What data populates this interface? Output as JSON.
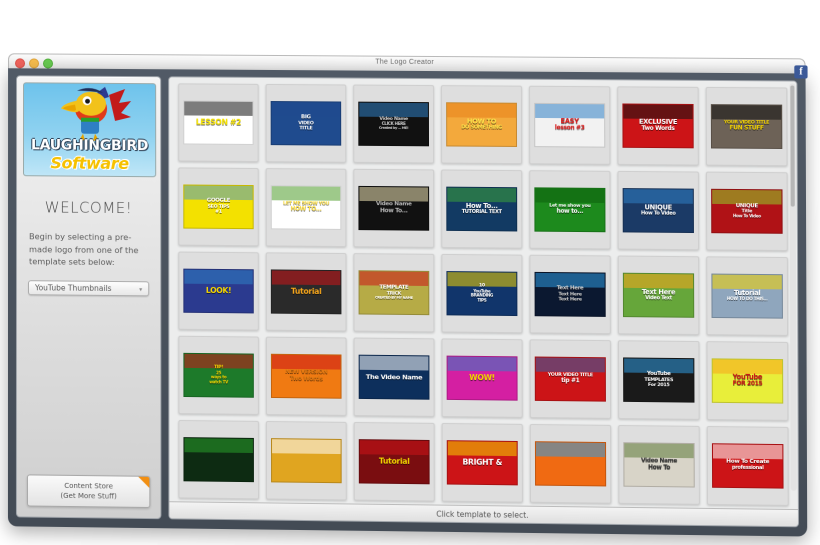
{
  "window": {
    "title": "The Logo Creator",
    "traffic_lights": [
      "close-red",
      "minimize-yellow",
      "zoom-green"
    ],
    "facebook_badge": "f"
  },
  "sidebar": {
    "logo": {
      "word1": "LAUGHINGBIRD",
      "word2": "Software",
      "icon": "parrot-mascot"
    },
    "welcome_heading": "WELCOME!",
    "instructions": "Begin by selecting a pre-made logo from one of the template sets below:",
    "template_set_select": {
      "value": "YouTube Thumbnails",
      "chevron": "▾"
    },
    "content_store": {
      "line1": "Content Store",
      "line2": "(Get More Stuff)",
      "corner_color": "#f28f12"
    }
  },
  "panel": {
    "status_text": "Click template to select.",
    "templates": [
      {
        "name": "lesson-2",
        "lines": [
          "LESSON #2"
        ],
        "bg": "#ffffff",
        "fg": "#f7e400",
        "accent": "#111111",
        "style": "pill-yellow"
      },
      {
        "name": "big-video-title",
        "lines": [
          "BIG",
          "VIDEO",
          "TITLE"
        ],
        "bg": "#1f4b8e",
        "fg": "#ffffff",
        "accent": "#1f4b8e",
        "style": "left-stack"
      },
      {
        "name": "video-name-click-here",
        "lines": [
          "Video Name",
          "CLICK HERE",
          "Created by ... ME!"
        ],
        "bg": "#111111",
        "fg": "#cfcfcf",
        "accent": "#2f7fc4",
        "style": "dark-center"
      },
      {
        "name": "how-to-do-something",
        "lines": [
          "HOW TO",
          "DO SOMETHING"
        ],
        "bg": "#f3a93c",
        "fg": "#ffe24a",
        "accent": "#e8821a",
        "style": "rays-orange"
      },
      {
        "name": "easy-lesson-3",
        "lines": [
          "EASY",
          "lesson #3"
        ],
        "bg": "#f2f2f2",
        "fg": "#e01b1b",
        "accent": "#2f7fc4",
        "style": "light-red"
      },
      {
        "name": "exclusive-two-words",
        "lines": [
          "EXCLUSIVE",
          "Two Words"
        ],
        "bg": "#cc1417",
        "fg": "#ffffff",
        "accent": "#111111",
        "style": "red-band"
      },
      {
        "name": "your-video-title-fun-stuff",
        "lines": [
          "YOUR VIDEO TITLE",
          "FUN STUFF"
        ],
        "bg": "#6d6257",
        "fg": "#f4d400",
        "accent": "#111111",
        "style": "tan-photo"
      },
      {
        "name": "google-seo-tips",
        "lines": [
          "GOOGLE",
          "SEO TIPS",
          "#1"
        ],
        "bg": "#f3e100",
        "fg": "#ffffff",
        "accent": "#4f9cc9",
        "style": "yellow-frame"
      },
      {
        "name": "let-me-show-you-how-to",
        "lines": [
          "LET ME SHOW YOU",
          "HOW TO..."
        ],
        "bg": "#ffffff",
        "fg": "#ffe24a",
        "accent": "#4e9c2a",
        "style": "green-band-top"
      },
      {
        "name": "video-name-how-to",
        "lines": [
          "Video Name",
          "How To..."
        ],
        "bg": "#111111",
        "fg": "#b9b9b9",
        "accent": "#efe4b4",
        "style": "dark-note"
      },
      {
        "name": "how-to-tutorial-text",
        "lines": [
          "How To...",
          "TUTORIAL TEXT"
        ],
        "bg": "#123a63",
        "fg": "#ffffff",
        "accent": "#3aa33a",
        "style": "split-green-blue"
      },
      {
        "name": "let-me-show-you-how-to-green",
        "lines": [
          "Let me show you",
          "how to..."
        ],
        "bg": "#1d8a1d",
        "fg": "#ffffff",
        "accent": "#0d5f0d",
        "style": "green-solid"
      },
      {
        "name": "unique-how-to-video",
        "lines": [
          "UNIQUE",
          "How To Video"
        ],
        "bg": "#1b3a66",
        "fg": "#ffffff",
        "accent": "#2f7fc4",
        "style": "blue-character"
      },
      {
        "name": "unique-title-how-to-video",
        "lines": [
          "UNIQUE",
          "Title",
          "How To Video"
        ],
        "bg": "#b01216",
        "fg": "#ffffff",
        "accent": "#8fd12a",
        "style": "red-character"
      },
      {
        "name": "look",
        "lines": [
          "LOOK!"
        ],
        "bg": "#2b3a8f",
        "fg": "#f4d400",
        "accent": "#2f7fc4",
        "style": "blue-photo"
      },
      {
        "name": "tutorial",
        "lines": [
          "Tutorial"
        ],
        "bg": "#2a2a2a",
        "fg": "#f7a61b",
        "accent": "#cc1417",
        "style": "dark-photo-orange"
      },
      {
        "name": "template-trick",
        "lines": [
          "TEMPLATE",
          "TRICK",
          "CREATED BY MY NAME"
        ],
        "bg": "#b6ab46",
        "fg": "#ffffff",
        "accent": "#cc1417",
        "style": "olive-rays"
      },
      {
        "name": "10-youtube-branding-tips",
        "lines": [
          "10",
          "YouTube",
          "BRANDING",
          "TIPS"
        ],
        "bg": "#11356b",
        "fg": "#ffffff",
        "accent": "#f4d400",
        "style": "navy-ten"
      },
      {
        "name": "text-here-x3",
        "lines": [
          "Text Here",
          "Text Here",
          "Text Here"
        ],
        "bg": "#0b1830",
        "fg": "#cfcfcf",
        "accent": "#2f9ae0",
        "style": "dark-three"
      },
      {
        "name": "text-here-video-text",
        "lines": [
          "Text Here",
          "Video Text"
        ],
        "bg": "#66a63a",
        "fg": "#ffffff",
        "accent": "#f7a61b",
        "style": "green-video"
      },
      {
        "name": "tutorial-how-to-do-this",
        "lines": [
          "Tutorial",
          "HOW TO DO THIS..."
        ],
        "bg": "#8fa6bd",
        "fg": "#ffffff",
        "accent": "#f4d400",
        "style": "blue-photo-tut"
      },
      {
        "name": "25-ways-to-watch-tv",
        "lines": [
          "TIP!",
          "25",
          "ways to",
          "watch TV"
        ],
        "bg": "#1d7a2a",
        "fg": "#f4d400",
        "accent": "#cc1417",
        "style": "green-25"
      },
      {
        "name": "new-version-two-words",
        "lines": [
          "NEW VERSION",
          "Two Words"
        ],
        "bg": "#f07a12",
        "fg": "#e07a12",
        "accent": "#cc1417",
        "style": "orange-two"
      },
      {
        "name": "the-video-name-cursor",
        "lines": [
          "The Video Name"
        ],
        "bg": "#0d2f5c",
        "fg": "#ffffff",
        "accent": "#ffffff",
        "style": "blue-cursor"
      },
      {
        "name": "wow",
        "lines": [
          "WOW!"
        ],
        "bg": "#d41fa2",
        "fg": "#f4d400",
        "accent": "#2f7fc4",
        "style": "magenta-wow"
      },
      {
        "name": "your-video-title-tip-1",
        "lines": [
          "YOUR VIDEO TITLE",
          "tip #1"
        ],
        "bg": "#cc1417",
        "fg": "#ffffff",
        "accent": "#2f5fa8",
        "style": "red-tip"
      },
      {
        "name": "youtube-templates-for-2015",
        "lines": [
          "YouTube",
          "TEMPLATES",
          "For 2015"
        ],
        "bg": "#1a1a1a",
        "fg": "#ffffff",
        "accent": "#2f9ae0",
        "style": "black-templates"
      },
      {
        "name": "youtube-for-2015",
        "lines": [
          "YouTube",
          "FOR 2015"
        ],
        "bg": "#e8ee3a",
        "fg": "#cc1417",
        "accent": "#f7a61b",
        "style": "lime-youtube"
      },
      {
        "name": "green-screen-woman",
        "lines": [
          ""
        ],
        "bg": "#0d2b12",
        "fg": "#ffffff",
        "accent": "#2aa02a",
        "style": "dark-green-photo"
      },
      {
        "name": "white-card-gold",
        "lines": [
          ""
        ],
        "bg": "#e0a520",
        "fg": "#333333",
        "accent": "#ffffff",
        "style": "gold-card"
      },
      {
        "name": "tutorial-red",
        "lines": [
          "Tutorial"
        ],
        "bg": "#7a0d10",
        "fg": "#f4d400",
        "accent": "#cc1417",
        "style": "red-tutorial"
      },
      {
        "name": "bright-and",
        "lines": [
          "BRIGHT &"
        ],
        "bg": "#cc1417",
        "fg": "#ffffff",
        "accent": "#f4d400",
        "style": "red-bright"
      },
      {
        "name": "play-button-orange",
        "lines": [
          ""
        ],
        "bg": "#f06a12",
        "fg": "#ffffff",
        "accent": "#2f9ae0",
        "style": "orange-play"
      },
      {
        "name": "video-name-how-to-board",
        "lines": [
          "Video Name",
          "How To"
        ],
        "bg": "#d8d4c8",
        "fg": "#333333",
        "accent": "#5e7a3a",
        "style": "chalk-board"
      },
      {
        "name": "how-to-create-professional",
        "lines": [
          "How To Create",
          "professional"
        ],
        "bg": "#cc1417",
        "fg": "#ffffff",
        "accent": "#ffffff",
        "style": "red-howto"
      }
    ]
  }
}
